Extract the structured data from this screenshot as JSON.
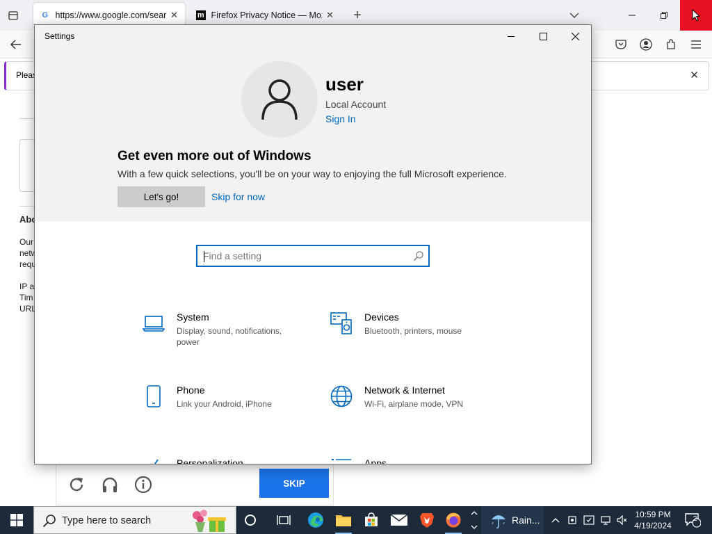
{
  "firefox": {
    "tabs": [
      {
        "title": "https://www.google.com/search",
        "favicon": "G"
      },
      {
        "title": "Firefox Privacy Notice — Mozilla",
        "favicon": "m"
      }
    ],
    "notification_text": "Pleas",
    "content_fragments": [
      "Abo",
      "Our",
      "netw",
      "requ",
      "IP a",
      "Tim",
      "URL"
    ]
  },
  "captcha": {
    "skip_label": "SKIP"
  },
  "settings": {
    "window_title": "Settings",
    "account": {
      "username": "user",
      "type": "Local Account",
      "signin_label": "Sign In"
    },
    "promo": {
      "title": "Get even more out of Windows",
      "subtitle": "With a few quick selections, you'll be on your way to enjoying the full Microsoft experience.",
      "primary_button": "Let's go!",
      "secondary_link": "Skip for now"
    },
    "search": {
      "placeholder": "Find a setting"
    },
    "categories": [
      {
        "title": "System",
        "description": "Display, sound, notifications, power",
        "icon": "laptop-icon"
      },
      {
        "title": "Devices",
        "description": "Bluetooth, printers, mouse",
        "icon": "devices-icon"
      },
      {
        "title": "Phone",
        "description": "Link your Android, iPhone",
        "icon": "phone-icon"
      },
      {
        "title": "Network & Internet",
        "description": "Wi-Fi, airplane mode, VPN",
        "icon": "globe-icon"
      },
      {
        "title": "Personalization",
        "description": "",
        "icon": "brush-icon"
      },
      {
        "title": "Apps",
        "description": "",
        "icon": "apps-icon"
      }
    ],
    "accent_color": "#0067c0"
  },
  "taskbar": {
    "search_placeholder": "Type here to search",
    "weather_text": "Rain...",
    "time": "10:59 PM",
    "date": "4/19/2024",
    "notification_count": "2"
  }
}
